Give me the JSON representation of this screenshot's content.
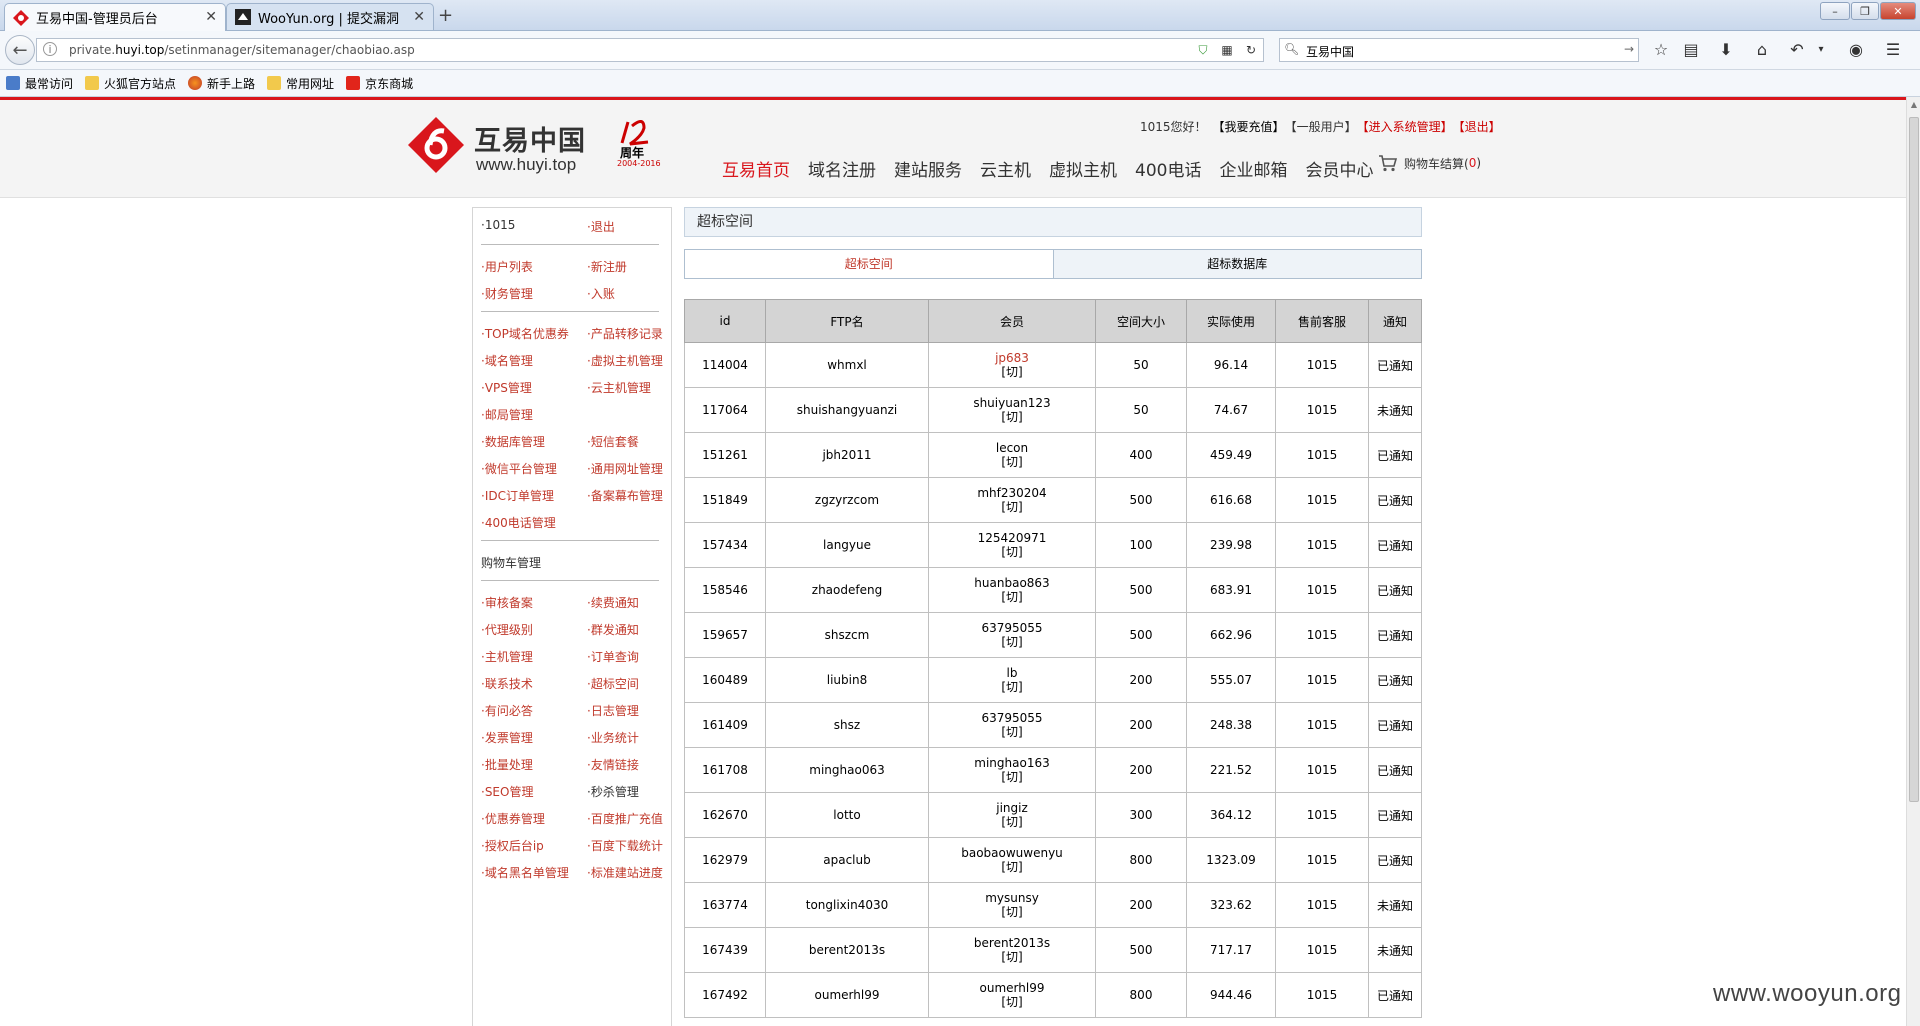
{
  "browser": {
    "tabs": [
      {
        "title": "互易中国-管理员后台"
      },
      {
        "title": "WooYun.org | 提交漏洞"
      }
    ],
    "url_prefix": "private.",
    "url_domain": "huyi.top",
    "url_path": "/setinmanager/sitemanager/chaobiao.asp",
    "search_text": "互易中国",
    "bookmarks": [
      "最常访问",
      "火狐官方站点",
      "新手上路",
      "常用网址",
      "京东商城"
    ]
  },
  "site": {
    "logo_text": "互易中国",
    "logo_url": "www.huyi.top",
    "anniv_year": "周年",
    "anniv_range": "2004-2016",
    "greeting": "1015您好！",
    "recharge": "【我要充值】",
    "user_type": "【一般用户】",
    "admin_link": "【进入系统管理】",
    "logout": "【退出】",
    "nav": [
      "互易首页",
      "域名注册",
      "建站服务",
      "云主机",
      "虚拟主机",
      "400电话",
      "企业邮箱",
      "会员中心"
    ],
    "cart_label": "购物车结算(",
    "cart_count": "0",
    "cart_close": ")"
  },
  "sidebar": {
    "rows": [
      {
        "l": "·1015",
        "r": "·退出"
      },
      {
        "l": "·用户列表",
        "r": "·新注册"
      },
      {
        "l": "·财务管理",
        "r": "·入账"
      },
      {
        "l": "·TOP域名优惠券",
        "r": "·产品转移记录"
      },
      {
        "l": "·域名管理",
        "r": "·虚拟主机管理"
      },
      {
        "l": "·VPS管理",
        "r": "·云主机管理"
      },
      {
        "l": "·邮局管理",
        "r": ""
      },
      {
        "l": "·数据库管理",
        "r": "·短信套餐"
      },
      {
        "l": "·微信平台管理",
        "r": "·通用网址管理"
      },
      {
        "l": "·IDC订单管理",
        "r": "·备案幕布管理"
      },
      {
        "l": "·400电话管理",
        "r": ""
      },
      {
        "l": "购物车管理",
        "r": ""
      },
      {
        "l": "·审核备案",
        "r": "·续费通知"
      },
      {
        "l": "·代理级别",
        "r": "·群发通知"
      },
      {
        "l": "·主机管理",
        "r": "·订单查询"
      },
      {
        "l": "·联系技术",
        "r": "·超标空间"
      },
      {
        "l": "·有问必答",
        "r": "·日志管理"
      },
      {
        "l": "·发票管理",
        "r": "·业务统计"
      },
      {
        "l": "·批量处理",
        "r": "·友情链接"
      },
      {
        "l": "·SEO管理",
        "r": "·秒杀管理"
      },
      {
        "l": "·优惠券管理",
        "r": "·百度推广充值"
      },
      {
        "l": "·授权后台ip",
        "r": "·百度下载统计"
      },
      {
        "l": "·域名黑名单管理",
        "r": "·标准建站进度"
      }
    ]
  },
  "content": {
    "title": "超标空间",
    "tab1": "超标空间",
    "tab2": "超标数据库",
    "columns": [
      "id",
      "FTP名",
      "会员",
      "空间大小",
      "实际使用",
      "售前客服",
      "通知"
    ],
    "switch_label": "[切]",
    "rows": [
      {
        "id": "114004",
        "ftp": "whmxl",
        "member": "jp683",
        "size": "50",
        "used": "96.14",
        "cs": "1015",
        "notice": "已通知"
      },
      {
        "id": "117064",
        "ftp": "shuishangyuanzi",
        "member": "shuiyuan123",
        "size": "50",
        "used": "74.67",
        "cs": "1015",
        "notice": "未通知"
      },
      {
        "id": "151261",
        "ftp": "jbh2011",
        "member": "lecon",
        "size": "400",
        "used": "459.49",
        "cs": "1015",
        "notice": "已通知"
      },
      {
        "id": "151849",
        "ftp": "zgzyrzcom",
        "member": "mhf230204",
        "size": "500",
        "used": "616.68",
        "cs": "1015",
        "notice": "已通知"
      },
      {
        "id": "157434",
        "ftp": "langyue",
        "member": "125420971",
        "size": "100",
        "used": "239.98",
        "cs": "1015",
        "notice": "已通知"
      },
      {
        "id": "158546",
        "ftp": "zhaodefeng",
        "member": "huanbao863",
        "size": "500",
        "used": "683.91",
        "cs": "1015",
        "notice": "已通知"
      },
      {
        "id": "159657",
        "ftp": "shszcm",
        "member": "63795055",
        "size": "500",
        "used": "662.96",
        "cs": "1015",
        "notice": "已通知"
      },
      {
        "id": "160489",
        "ftp": "liubin8",
        "member": "lb",
        "size": "200",
        "used": "555.07",
        "cs": "1015",
        "notice": "已通知"
      },
      {
        "id": "161409",
        "ftp": "shsz",
        "member": "63795055",
        "size": "200",
        "used": "248.38",
        "cs": "1015",
        "notice": "已通知"
      },
      {
        "id": "161708",
        "ftp": "minghao063",
        "member": "minghao163",
        "size": "200",
        "used": "221.52",
        "cs": "1015",
        "notice": "已通知"
      },
      {
        "id": "162670",
        "ftp": "lotto",
        "member": "jingiz",
        "size": "300",
        "used": "364.12",
        "cs": "1015",
        "notice": "已通知"
      },
      {
        "id": "162979",
        "ftp": "apaclub",
        "member": "baobaowuwenyu",
        "size": "800",
        "used": "1323.09",
        "cs": "1015",
        "notice": "已通知"
      },
      {
        "id": "163774",
        "ftp": "tonglixin4030",
        "member": "mysunsy",
        "size": "200",
        "used": "323.62",
        "cs": "1015",
        "notice": "未通知"
      },
      {
        "id": "167439",
        "ftp": "berent2013s",
        "member": "berent2013s",
        "size": "500",
        "used": "717.17",
        "cs": "1015",
        "notice": "未通知"
      },
      {
        "id": "167492",
        "ftp": "oumerhl99",
        "member": "oumerhl99",
        "size": "800",
        "used": "944.46",
        "cs": "1015",
        "notice": "已通知"
      }
    ]
  },
  "watermark": "www.wooyun.org",
  "colors": {
    "brand_red": "#d9161c",
    "link_red": "#c0392b",
    "ok_green": "#2d9a2d",
    "no_red": "#e00000"
  }
}
